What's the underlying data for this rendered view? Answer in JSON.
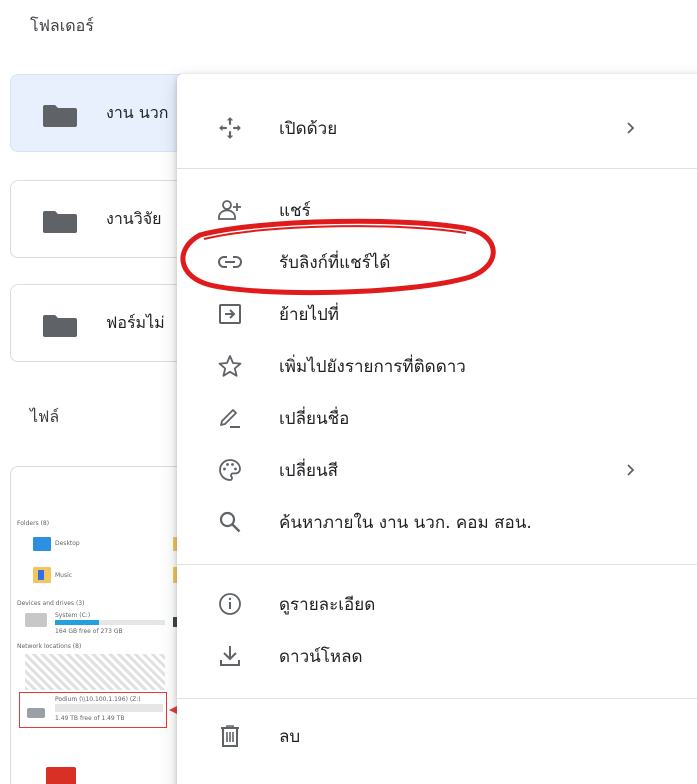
{
  "sections": {
    "folders_label": "โฟลเดอร์",
    "files_label": "ไฟล์"
  },
  "folders": [
    {
      "name": "งาน นวก",
      "selected": true
    },
    {
      "name": "งานวิจัย",
      "selected": false
    },
    {
      "name": "ฟอร์มไม่",
      "selected": false
    }
  ],
  "file_thumbnail": {
    "folders_header": "Folders (8)",
    "desktop": "Desktop",
    "music": "Music",
    "devices_header": "Devices and drives (3)",
    "system_drive": "System (C:)",
    "system_free": "164 GB free of 273 GB",
    "network_header": "Network locations (8)",
    "network_drive": "Podium (\\\\10.100.1.196) (Z:)",
    "network_free": "1.49 TB free of 1.49 TB"
  },
  "context_menu": {
    "items": [
      {
        "label": "เปิดด้วย",
        "icon": "move-arrows-icon",
        "submenu": true
      },
      {
        "label": "แชร์",
        "icon": "person-add-icon",
        "submenu": false
      },
      {
        "label": "รับลิงก์ที่แชร์ได้",
        "icon": "link-icon",
        "submenu": false
      },
      {
        "label": "ย้ายไปที่",
        "icon": "move-to-icon",
        "submenu": false
      },
      {
        "label": "เพิ่มไปยังรายการที่ติดดาว",
        "icon": "star-icon",
        "submenu": false
      },
      {
        "label": "เปลี่ยนชื่อ",
        "icon": "pencil-icon",
        "submenu": false
      },
      {
        "label": "เปลี่ยนสี",
        "icon": "palette-icon",
        "submenu": true
      },
      {
        "label": "ค้นหาภายใน งาน นวก. คอม สอน.",
        "icon": "search-icon",
        "submenu": false
      },
      {
        "label": "ดูรายละเอียด",
        "icon": "info-icon",
        "submenu": false
      },
      {
        "label": "ดาวน์โหลด",
        "icon": "download-icon",
        "submenu": false
      },
      {
        "label": "ลบ",
        "icon": "trash-icon",
        "submenu": false
      }
    ]
  },
  "colors": {
    "highlight_annotation": "#e01b1b",
    "folder_icon": "#5f6368",
    "selected_folder_bg": "#e8f0fe"
  }
}
